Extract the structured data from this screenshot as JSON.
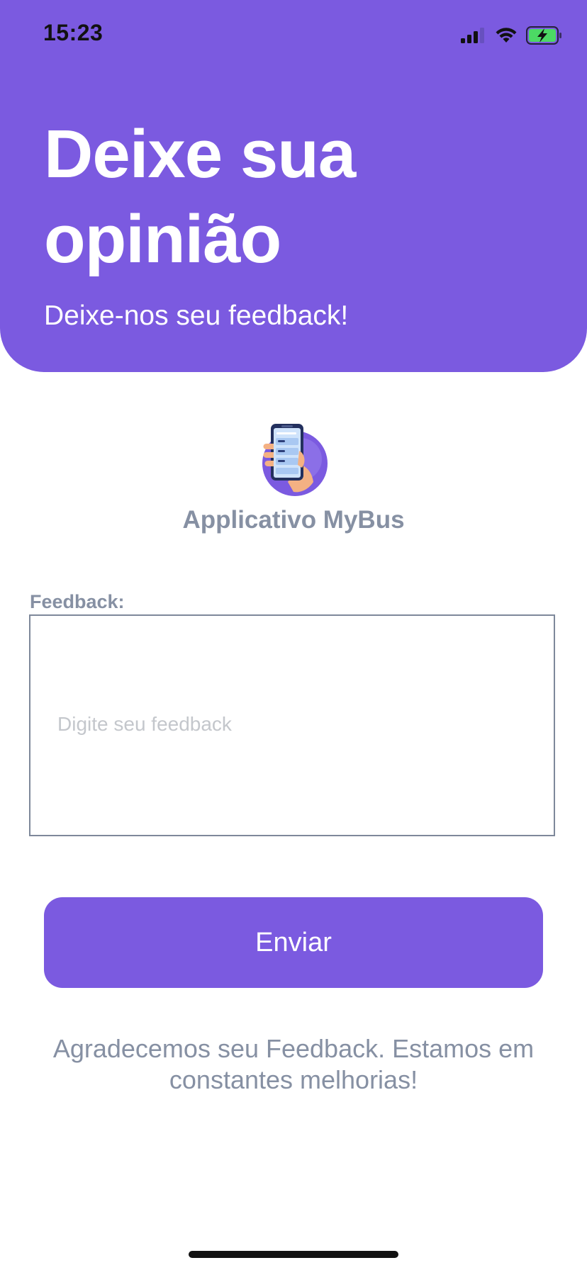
{
  "status_bar": {
    "time": "15:23",
    "icons": [
      "cellular-signal-icon",
      "wifi-icon",
      "battery-charging-icon"
    ]
  },
  "header": {
    "title": "Deixe sua opinião",
    "subtitle": "Deixe-nos seu feedback!"
  },
  "app": {
    "logo_icon": "phone-in-hand-icon",
    "name": "Applicativo MyBus"
  },
  "feedback": {
    "label": "Feedback:",
    "value": "",
    "placeholder": "Digite seu feedback"
  },
  "send_button": {
    "label": "Enviar"
  },
  "thanks_message": "Agradecemos seu Feedback. Estamos em constantes melhorias!",
  "colors": {
    "accent": "#7b5ae0",
    "muted_text": "#8690a3",
    "border": "#7e889a"
  }
}
